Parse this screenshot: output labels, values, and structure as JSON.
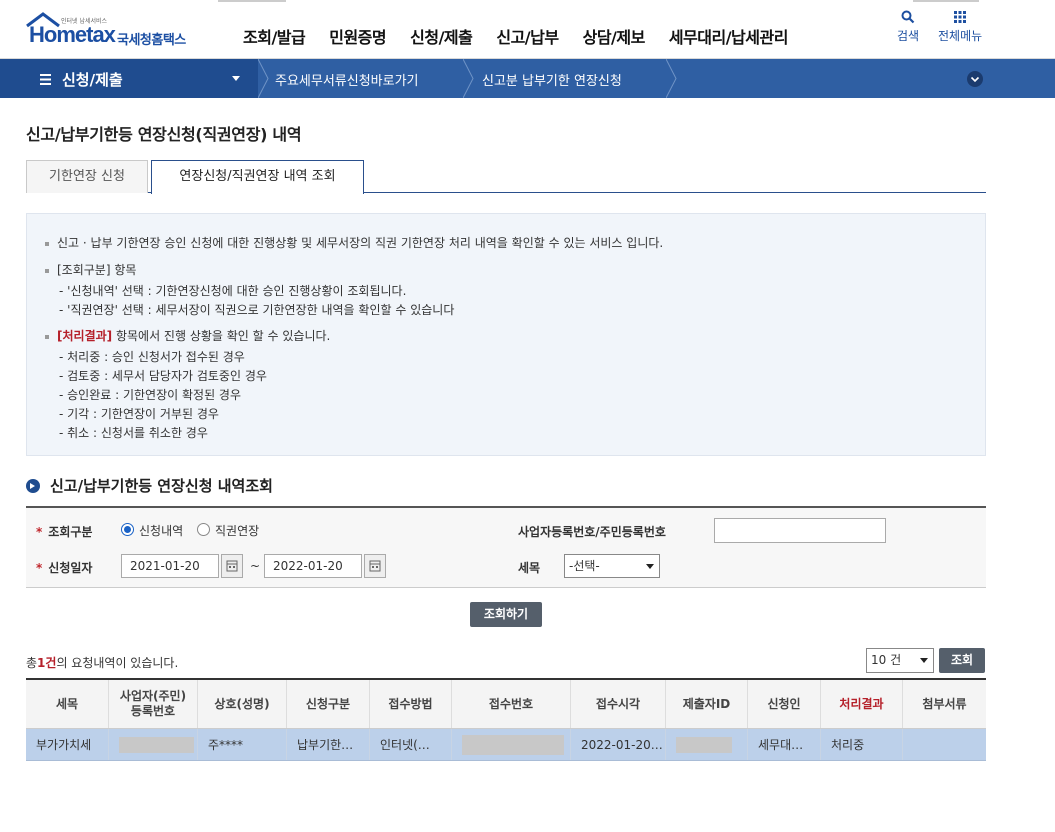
{
  "header": {
    "logo_sub": "인터넷 납세서비스",
    "logo_brand": "Hometax",
    "logo_kr": "국세청홈택스",
    "menu": [
      "조회/발급",
      "민원증명",
      "신청/제출",
      "신고/납부",
      "상담/제보",
      "세무대리/납세관리"
    ],
    "search_label": "검색",
    "all_menu_label": "전체메뉴"
  },
  "subnav": {
    "title": "신청/제출",
    "crumbs": [
      "주요세무서류신청바로가기",
      "신고분 납부기한 연장신청"
    ]
  },
  "page": {
    "title": "신고/납부기한등 연장신청(직권연장) 내역"
  },
  "tabs": [
    "기한연장 신청",
    "연장신청/직권연장 내역 조회"
  ],
  "info": {
    "line1": "신고 · 납부 기한연장 승인 신청에 대한 진행상황 및 세무서장의 직권 기한연장 처리 내역을 확인할 수 있는 서비스 입니다.",
    "line2": "[조회구분] 항목",
    "line2_subs": [
      "- '신청내역' 선택 : 기한연장신청에 대한 승인 진행상황이 조회됩니다.",
      "- '직권연장' 선택 : 세무서장이 직권으로 기한연장한 내역을 확인할 수 있습니다"
    ],
    "line3_highlight": "[처리결과]",
    "line3_rest": " 항목에서 진행 상황을 확인 할 수 있습니다.",
    "line3_subs": [
      "- 처리중 : 승인 신청서가 접수된 경우",
      "- 검토중 : 세무서 담당자가 검토중인 경우",
      "- 승인완료 : 기한연장이 확정된 경우",
      "- 기각 : 기한연장이 거부된 경우",
      "- 취소 : 신청서를 취소한 경우"
    ]
  },
  "section_title": "신고/납부기한등 연장신청 내역조회",
  "form": {
    "type_label": "조회구분",
    "radio_1": "신청내역",
    "radio_2": "직권연장",
    "radio_selected": "신청내역",
    "date_label": "신청일자",
    "date_from": "2021-01-20",
    "date_sep": "~",
    "date_to": "2022-01-20",
    "biz_label": "사업자등록번호/주민등록번호",
    "biz_value": "",
    "tax_label": "세목",
    "tax_selected": "-선택-",
    "search_button": "조회하기"
  },
  "results": {
    "count_prefix": "총",
    "count_value": "1건",
    "count_suffix": "의 요청내역이 있습니다.",
    "page_size": "10 건",
    "go_button": "조회",
    "columns": [
      "세목",
      "사업자(주민)\n등록번호",
      "상호(성명)",
      "신청구분",
      "접수방법",
      "접수번호",
      "접수시각",
      "제출자ID",
      "신청인",
      "처리결과",
      "첨부서류"
    ],
    "rows": [
      [
        "부가가치세",
        "",
        "주****",
        "납부기한…",
        "인터넷(…",
        "",
        "2022-01-20…",
        "",
        "세무대…",
        "처리중",
        ""
      ]
    ]
  },
  "colors": {
    "primary": "#1f4c8f",
    "subnav": "#2f5fa3",
    "highlight_red": "#b5202a",
    "selected_row": "#bcd0ea"
  }
}
